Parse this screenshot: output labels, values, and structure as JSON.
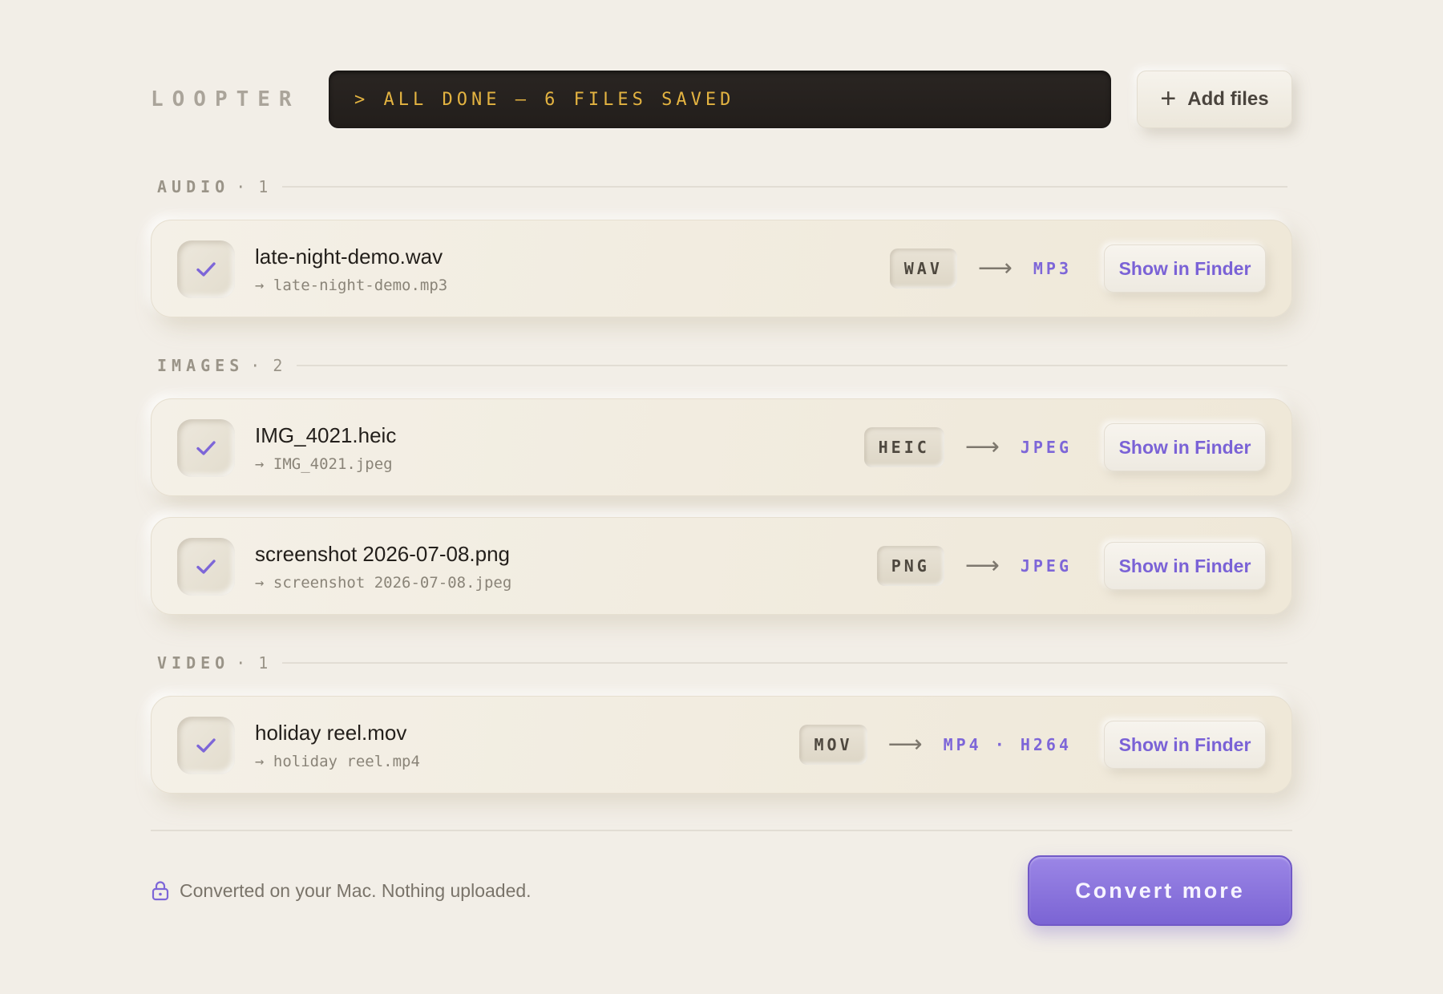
{
  "app": {
    "logo": "LOOPTER",
    "status": "> ALL DONE — 6 FILES SAVED",
    "add_files_label": "Add files"
  },
  "sections": [
    {
      "name": "AUDIO",
      "count": "· 1",
      "files": [
        {
          "name": "late-night-demo.wav",
          "output": "→ late-night-demo.mp3",
          "from": "WAV",
          "arrow": "⟶",
          "to": "MP3",
          "action": "Show in Finder"
        }
      ]
    },
    {
      "name": "IMAGES",
      "count": "· 2",
      "files": [
        {
          "name": "IMG_4021.heic",
          "output": "→ IMG_4021.jpeg",
          "from": "HEIC",
          "arrow": "⟶",
          "to": "JPEG",
          "action": "Show in Finder"
        },
        {
          "name": "screenshot 2026-07-08.png",
          "output": "→ screenshot 2026-07-08.jpeg",
          "from": "PNG",
          "arrow": "⟶",
          "to": "JPEG",
          "action": "Show in Finder"
        }
      ]
    },
    {
      "name": "VIDEO",
      "count": "· 1",
      "files": [
        {
          "name": "holiday reel.mov",
          "output": "→ holiday reel.mp4",
          "from": "MOV",
          "arrow": "⟶",
          "to": "MP4 · H264",
          "action": "Show in Finder"
        }
      ]
    }
  ],
  "footer": {
    "privacy_text": "Converted on your Mac. Nothing uploaded.",
    "convert_label": "Convert more"
  },
  "colors": {
    "background": "#f2eee7",
    "accent": "#7d66d8",
    "terminal_text": "#e3b341",
    "terminal_bg": "#231f1c"
  },
  "icons": {
    "add": "plus-icon",
    "done": "checkmark-icon",
    "privacy": "lock-icon"
  }
}
